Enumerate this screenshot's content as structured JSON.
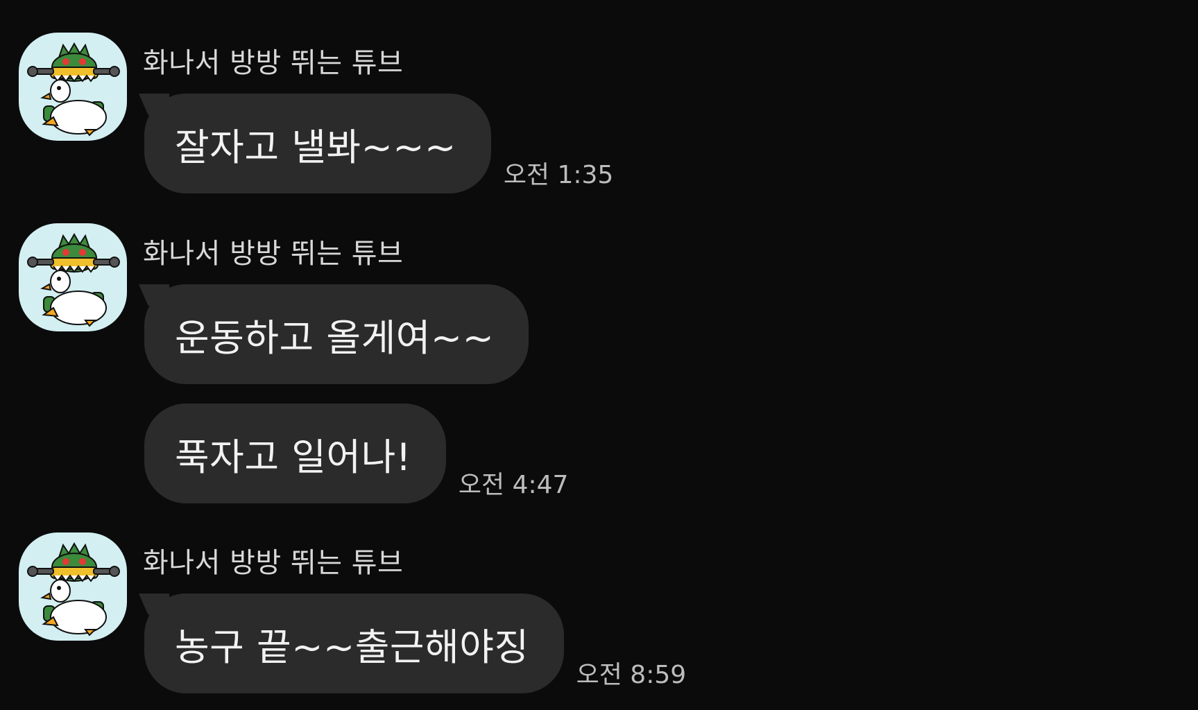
{
  "colors": {
    "background": "#0b0b0b",
    "bubble": "#2b2b2b",
    "avatar_bg": "#d3eff2",
    "sender_text": "#d8d8d8",
    "time_text": "#bdbdbd"
  },
  "messages": [
    {
      "sender": "화나서 방방 뛰는 튜브",
      "avatar_icon": "tube-character-avatar-icon",
      "bubbles": [
        {
          "text": "잘자고 낼봐~~~",
          "time": "오전 1:35"
        }
      ]
    },
    {
      "sender": "화나서 방방 뛰는 튜브",
      "avatar_icon": "tube-character-avatar-icon",
      "bubbles": [
        {
          "text": "운동하고 올게여~~",
          "time": ""
        },
        {
          "text": "푹자고 일어나!",
          "time": "오전 4:47"
        }
      ]
    },
    {
      "sender": "화나서 방방 뛰는 튜브",
      "avatar_icon": "tube-character-avatar-icon",
      "bubbles": [
        {
          "text": "농구 끝~~출근해야징",
          "time": "오전 8:59"
        }
      ]
    }
  ]
}
